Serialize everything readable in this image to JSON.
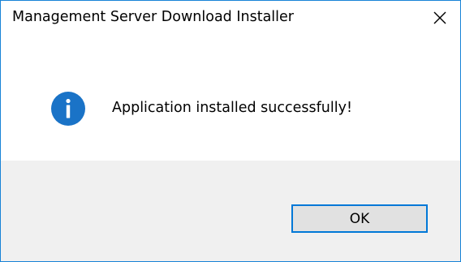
{
  "window": {
    "title": "Management Server Download Installer",
    "close_icon": "close-icon"
  },
  "message": {
    "icon": "info-icon",
    "text": "Application installed successfully!"
  },
  "buttons": {
    "ok_label": "OK"
  },
  "colors": {
    "border": "#1883d7",
    "info_icon_bg": "#1a73c7",
    "footer_bg": "#f0f0f0",
    "button_bg": "#e1e1e1",
    "button_focus_border": "#0078d7"
  }
}
